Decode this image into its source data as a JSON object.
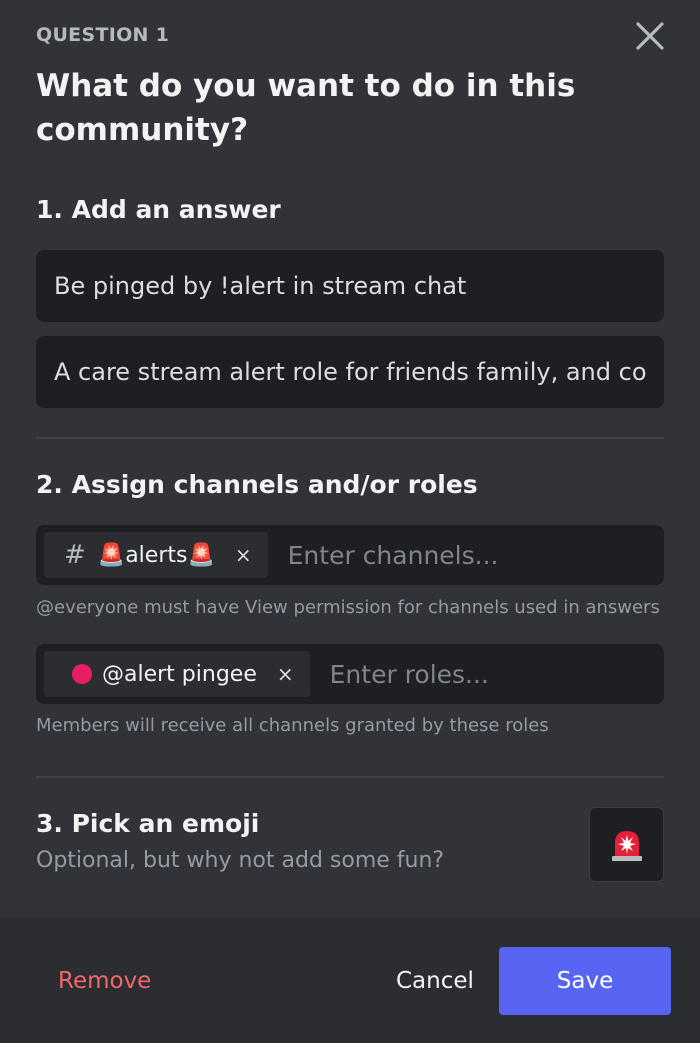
{
  "header": {
    "question_label": "QUESTION 1",
    "title": "What do you want to do in this community?",
    "close_icon": "close-icon"
  },
  "answer_section": {
    "title": "1. Add an answer",
    "answer_value": "Be pinged by !alert in stream chat",
    "description_value": "A care stream alert role for friends family, and co"
  },
  "assign_section": {
    "title": "2. Assign channels and/or roles",
    "channel_chip": {
      "prefix": "#",
      "emoji_left": "🚨",
      "name": "alerts",
      "emoji_right": "🚨",
      "remove": "×"
    },
    "channels_placeholder": "Enter channels...",
    "channels_hint": "@everyone must have View permission for channels used in answers",
    "role_chip": {
      "color": "#e91e63",
      "name": "@alert pingee",
      "remove": "×"
    },
    "roles_placeholder": "Enter roles...",
    "roles_hint": "Members will receive all channels granted by these roles"
  },
  "emoji_section": {
    "title": "3. Pick an emoji",
    "subtitle": "Optional, but why not add some fun?",
    "selected_emoji": "🚨"
  },
  "footer": {
    "remove_label": "Remove",
    "cancel_label": "Cancel",
    "save_label": "Save"
  },
  "colors": {
    "background": "#313338",
    "input": "#1e1f22",
    "footer": "#2b2d31",
    "accent": "#5865f2",
    "danger": "#f0686a"
  }
}
